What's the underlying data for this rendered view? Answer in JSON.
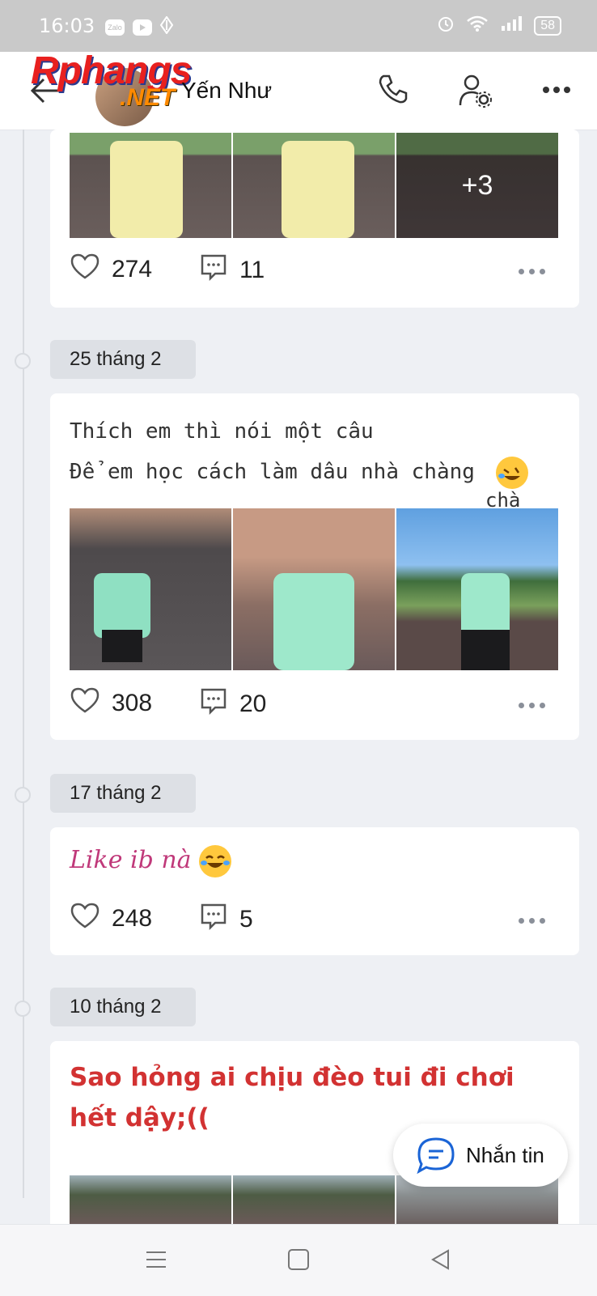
{
  "status_bar": {
    "time": "16:03",
    "battery": "58",
    "app_icons": [
      "zalo-icon",
      "youtube-icon",
      "vpn-icon"
    ],
    "system_icons": [
      "alarm-icon",
      "wifi-icon",
      "signal-icon",
      "battery-icon"
    ]
  },
  "header": {
    "name": "Yến Như",
    "watermark_line1": "Rphangs",
    "watermark_line2": ".NET"
  },
  "posts": [
    {
      "photos_more": "+3",
      "likes": "274",
      "comments": "11"
    },
    {
      "date": "25 tháng 2",
      "text_line1": "Thích em thì nói một câu",
      "text_line2": "Để em học cách làm dâu nhà chàng",
      "photo_caption": "chà",
      "likes": "308",
      "comments": "20"
    },
    {
      "date": "17 tháng 2",
      "text": "Like ib nà",
      "likes": "248",
      "comments": "5"
    },
    {
      "date": "10 tháng 2",
      "text_line1": "Sao hỏng ai chịu đèo tui đi chơi",
      "text_line2": "hết dậy;(("
    }
  ],
  "fab": {
    "label": "Nhắn tin"
  },
  "colors": {
    "accent": "#1a64d6",
    "pink_text": "#c0397a",
    "red_text": "#d23232",
    "chip_bg": "#dde0e5"
  }
}
